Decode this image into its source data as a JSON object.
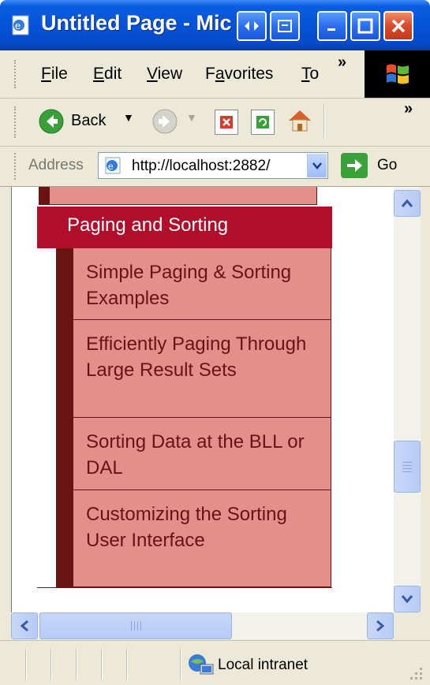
{
  "window": {
    "title": "Untitled Page - Microsoft Internet Explorer",
    "title_visible": "Untitled Page - Mic"
  },
  "menu": {
    "items": [
      {
        "label": "File",
        "accel": "F",
        "rest": "ile"
      },
      {
        "label": "Edit",
        "accel": "E",
        "rest": "dit"
      },
      {
        "label": "View",
        "accel": "V",
        "rest": "iew"
      },
      {
        "label": "Favorites",
        "accel": "a",
        "pre": "F",
        "rest": "vorites"
      },
      {
        "label": "To",
        "accel": "T",
        "rest": "o"
      }
    ],
    "overflow": "»"
  },
  "toolbar": {
    "back_label": "Back",
    "overflow": "»"
  },
  "address": {
    "label": "Address",
    "url": "http://localhost:2882/",
    "go_label": "Go"
  },
  "content": {
    "section_header": "Paging and Sorting",
    "items": [
      "Simple Paging & Sorting Examples",
      "Efficiently Paging Through Large Result Sets",
      "Sorting Data at the BLL or DAL",
      "Customizing the Sorting User Interface"
    ]
  },
  "status": {
    "zone": "Local intranet"
  },
  "colors": {
    "header": "#b00e2a",
    "item_bg": "#e58f8c",
    "sidebar": "#6b1212",
    "item_text": "#6b1212"
  }
}
